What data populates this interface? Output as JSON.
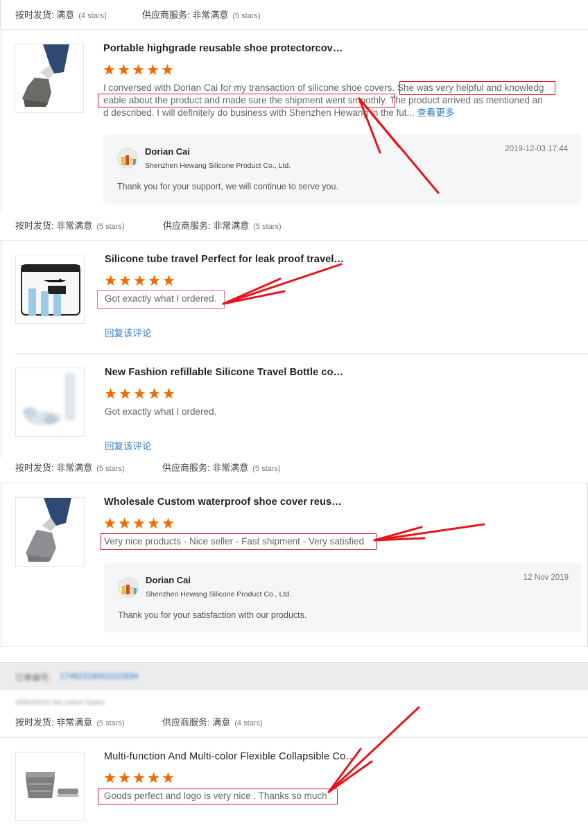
{
  "ratings": [
    {
      "ship_label": "按时发货:",
      "ship_value": "满意",
      "ship_stars": "(4 stars)",
      "svc_label": "供应商服务:",
      "svc_value": "非常满意",
      "svc_stars": "(5 stars)"
    },
    {
      "ship_label": "按时发货:",
      "ship_value": "非常满意",
      "ship_stars": "(5 stars)",
      "svc_label": "供应商服务:",
      "svc_value": "非常满意",
      "svc_stars": "(5 stars)"
    },
    {
      "ship_label": "按时发货:",
      "ship_value": "非常满意",
      "ship_stars": "(5 stars)",
      "svc_label": "供应商服务:",
      "svc_value": "非常满意",
      "svc_stars": "(5 stars)"
    },
    {
      "ship_label": "按时发货:",
      "ship_value": "非常满意",
      "ship_stars": "(5 stars)",
      "svc_label": "供应商服务:",
      "svc_value": "满意",
      "svc_stars": "(4 stars)"
    }
  ],
  "reviews": [
    {
      "title": "Portable highgrade reusable shoe protectorcov…",
      "stars": 5,
      "text_lines": [
        "I conversed with Dorian Cai for my transaction of silicone shoe covers. She was very helpful and knowledg",
        "eable about the product and made sure the shipment went smoothly. The product arrived as mentioned an",
        "d described. I will definitely do business with Shenzhen Hewang in the fut..."
      ],
      "more_link": "查看更多",
      "reply": {
        "name": "Dorian Cai",
        "company": "Shenzhen Hewang Silicone Product Co., Ltd.",
        "date": "2019-12-03 17:44",
        "message": "Thank you for your support, we will continue to serve you."
      }
    },
    {
      "title": "Silicone tube travel Perfect for leak proof travel…",
      "stars": 5,
      "text": "Got exactly what I ordered.",
      "reply_link": "回复该评论"
    },
    {
      "title": "New Fashion refillable Silicone Travel Bottle co…",
      "stars": 5,
      "text": "Got exactly what I ordered.",
      "reply_link": "回复该评论"
    },
    {
      "title": "Wholesale Custom waterproof shoe cover reus…",
      "stars": 5,
      "text": "Very nice products - Nice seller - Fast shipment - Very satisfied",
      "reply": {
        "name": "Dorian Cai",
        "company": "Shenzhen Hewang Silicone Product Co., Ltd.",
        "date": "12 Nov 2019",
        "message": "Thank you for your satisfaction with our products."
      }
    },
    {
      "title": "Multi-function And Multi-color Flexible Collapsible Co…",
      "stars": 5,
      "text": "Goods perfect and logo is very nice . Thanks so much"
    }
  ],
  "order": {
    "label": "订单编号:",
    "number": "17492318001022694",
    "buyer": "308502925 NA,United States"
  },
  "colors": {
    "star": "#f56a00",
    "link": "#2a7bd0",
    "annotation": "#d9162a"
  }
}
